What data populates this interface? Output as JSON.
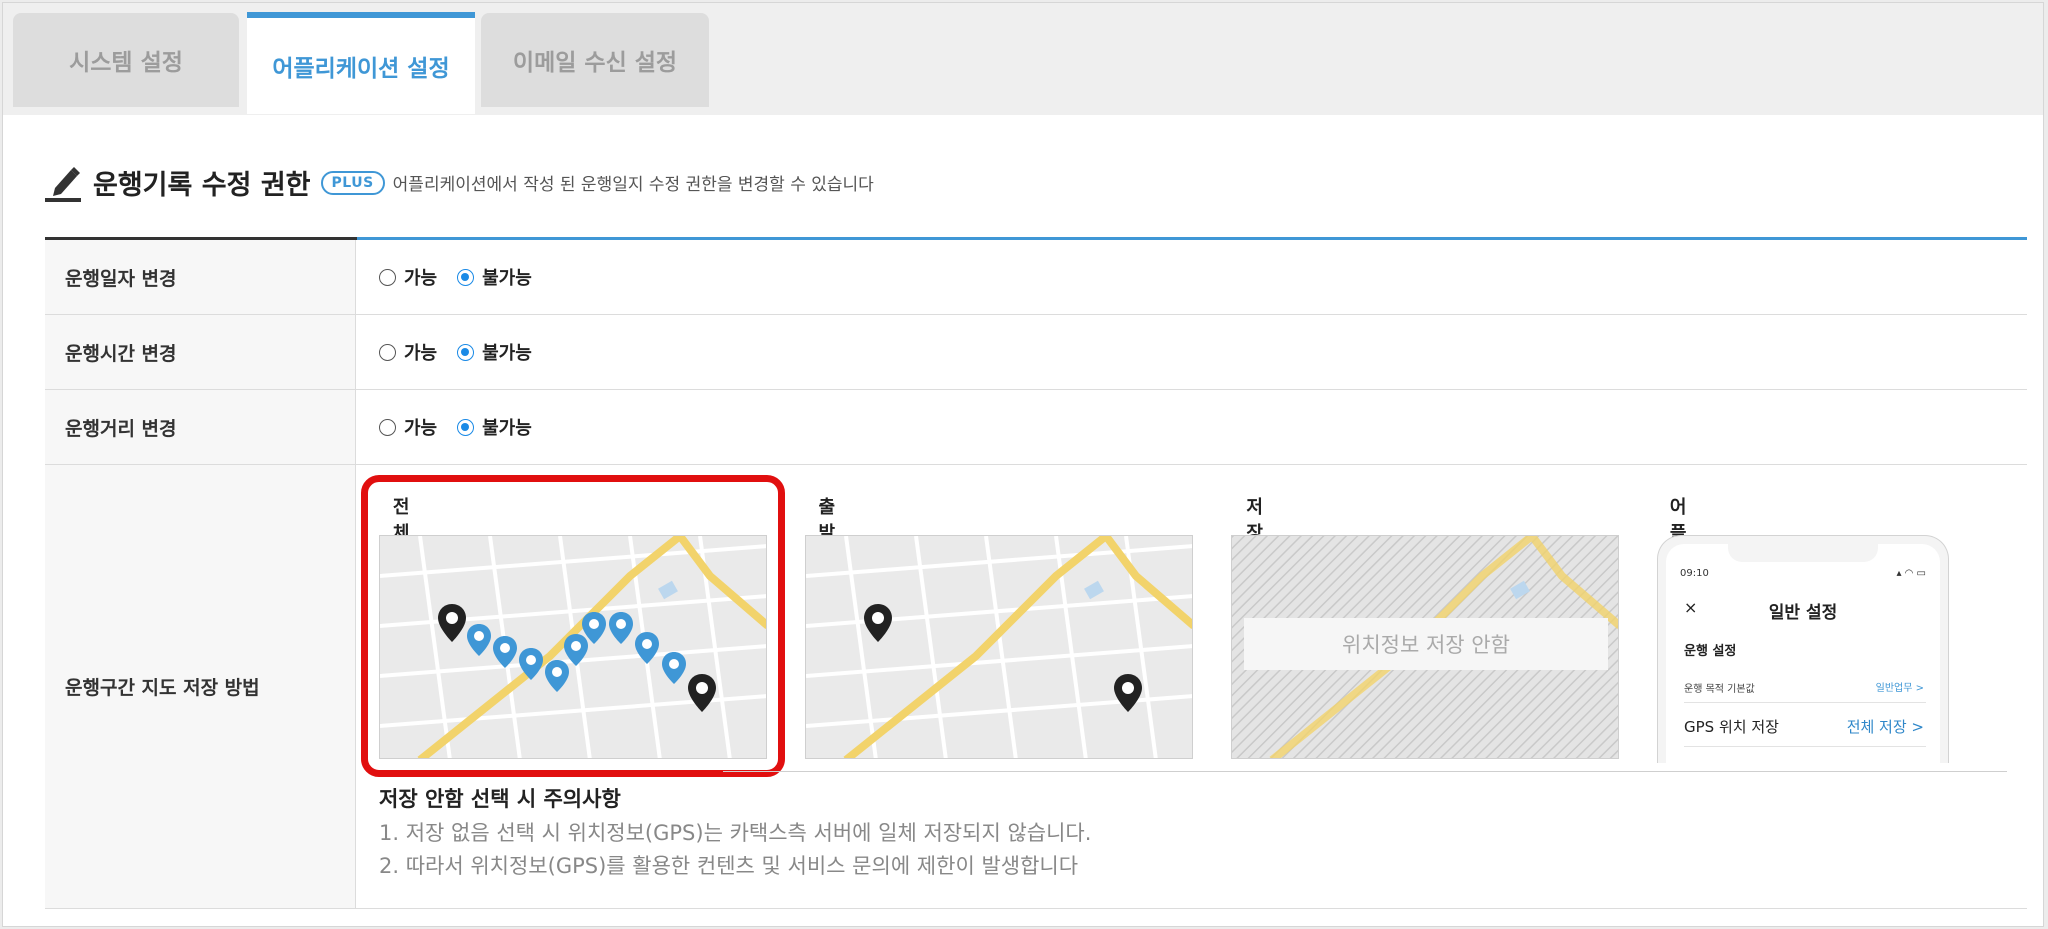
{
  "tabs": [
    {
      "label": "시스템 설정"
    },
    {
      "label": "어플리케이션 설정"
    },
    {
      "label": "이메일 수신 설정"
    }
  ],
  "section": {
    "title": "운행기록 수정 권한",
    "badge": "PLUS",
    "description": "어플리케이션에서 작성 된 운행일지 수정 권한을 변경할 수 있습니다"
  },
  "rows": [
    {
      "label": "운행일자 변경",
      "options": [
        "가능",
        "불가능"
      ],
      "selected": "불가능"
    },
    {
      "label": "운행시간 변경",
      "options": [
        "가능",
        "불가능"
      ],
      "selected": "불가능"
    },
    {
      "label": "운행거리 변경",
      "options": [
        "가능",
        "불가능"
      ],
      "selected": "불가능"
    }
  ],
  "map_row": {
    "label": "운행구간 지도 저장 방법",
    "options": [
      {
        "label": "전체구간 저장",
        "checked": true
      },
      {
        "label": "출발, 도착지만 저장",
        "checked": false
      },
      {
        "label": "저장 안함",
        "checked": false
      },
      {
        "label": "어플 내 사용자 선택",
        "checked": false
      }
    ],
    "no_save_overlay": "위치정보 저장 안함",
    "phone": {
      "time": "09:10",
      "close": "×",
      "title": "일반 설정",
      "section": "운행 설정",
      "row1_label": "운행 목적 기본값",
      "row1_value": "일반업무 >",
      "row2_label": "GPS 위치 저장",
      "row2_value": "전체 저장 >"
    },
    "notice": {
      "title": "저장 안함 선택 시 주의사항",
      "items": [
        "1. 저장 없음 선택 시 위치정보(GPS)는 카택스측 서버에 일체 저장되지 않습니다.",
        "2. 따라서 위치정보(GPS)를 활용한 컨텐츠 및 서비스 문의에 제한이 발생합니다"
      ]
    }
  },
  "colors": {
    "accent": "#3f97d6",
    "radio": "#1a8ae6",
    "highlight": "#e10f0f",
    "road": "#f2d36b"
  }
}
